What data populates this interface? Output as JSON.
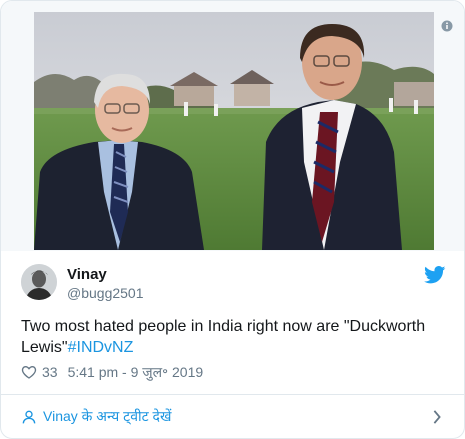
{
  "tweet": {
    "author": {
      "name": "Vinay",
      "handle": "@bugg2501"
    },
    "text_main": "Two most hated people in India right now are \"Duckworth Lewis\"",
    "hashtag": "#INDvNZ",
    "likes": "33",
    "timestamp": "5:41 pm - 9 जुल॰ 2019",
    "more_link": "Vinay के अन्य ट्वीट देखें"
  },
  "icons": {
    "info": "info-icon",
    "brand": "twitter-bird-icon",
    "like": "heart-icon",
    "profile": "person-icon",
    "next": "chevron-right-icon"
  },
  "colors": {
    "link": "#1b95e0",
    "secondary_text": "#657786",
    "border": "#e1e8ed",
    "media_background": "#f5f8fa"
  }
}
